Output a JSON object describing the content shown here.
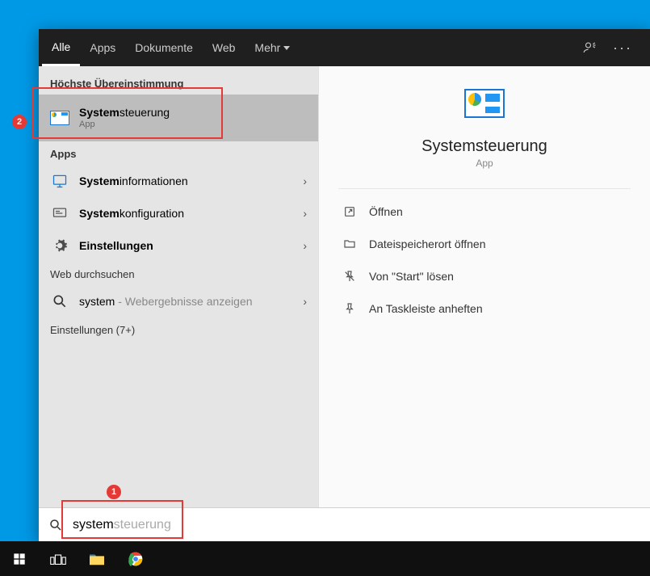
{
  "tabs": {
    "all": "Alle",
    "apps": "Apps",
    "docs": "Dokumente",
    "web": "Web",
    "more": "Mehr"
  },
  "left": {
    "best_match_header": "Höchste Übereinstimmung",
    "best": {
      "title_bold": "System",
      "title_rest": "steuerung",
      "sub": "App"
    },
    "apps_header": "Apps",
    "app1_bold": "System",
    "app1_rest": "informationen",
    "app2_bold": "System",
    "app2_rest": "konfiguration",
    "app3": "Einstellungen",
    "web_header": "Web durchsuchen",
    "web_item_bold": "system",
    "web_item_dash": " - Webergebnisse anzeigen",
    "settings_header": "Einstellungen (7+)"
  },
  "right": {
    "title": "Systemsteuerung",
    "sub": "App",
    "actions": {
      "open": "Öffnen",
      "file_location": "Dateispeicherort öffnen",
      "unpin_start": "Von \"Start\" lösen",
      "pin_taskbar": "An Taskleiste anheften"
    }
  },
  "search": {
    "typed": "system",
    "suggestion": "steuerung"
  },
  "annotations": {
    "one": "1",
    "two": "2"
  }
}
